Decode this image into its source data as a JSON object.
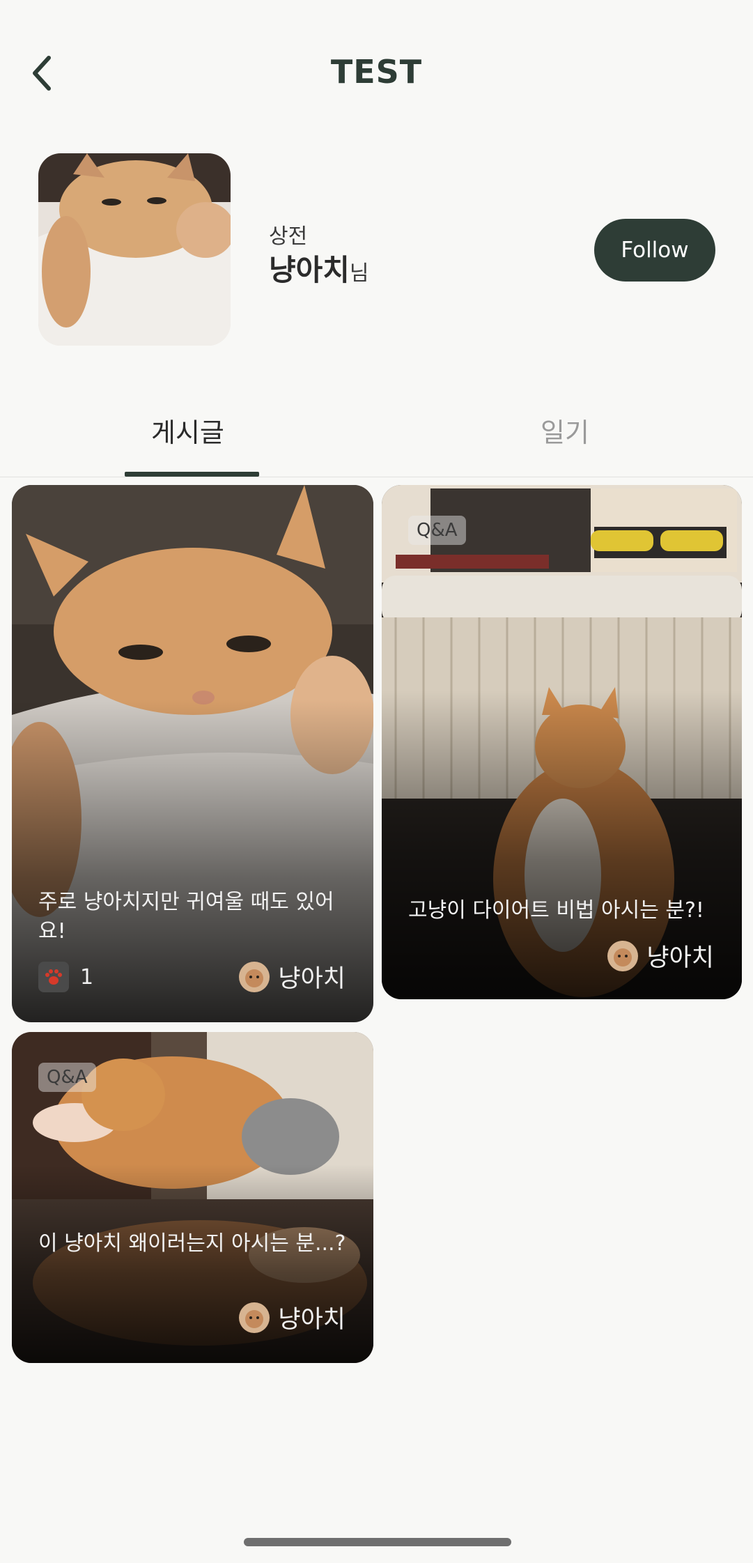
{
  "header": {
    "title": "TEST",
    "back_icon": "chevron-left-icon"
  },
  "profile": {
    "label": "상전",
    "name": "냥아치",
    "name_suffix": "님",
    "follow_label": "Follow"
  },
  "tabs": [
    {
      "label": "게시글",
      "selected": true
    },
    {
      "label": "일기",
      "selected": false
    }
  ],
  "posts": [
    {
      "title": "주로 냥아치지만 귀여울 때도 있어요!",
      "likes": "1",
      "author": "냥아치",
      "badge": ""
    },
    {
      "title": "고냥이 다이어트 비법 아시는 분?!",
      "author": "냥아치",
      "badge": "Q&A"
    },
    {
      "title": "이 냥아치 왜이러는지 아시는 분...?",
      "author": "냥아치",
      "badge": "Q&A"
    }
  ],
  "colors": {
    "accent": "#2e3d36",
    "paw": "#d63a2a"
  }
}
